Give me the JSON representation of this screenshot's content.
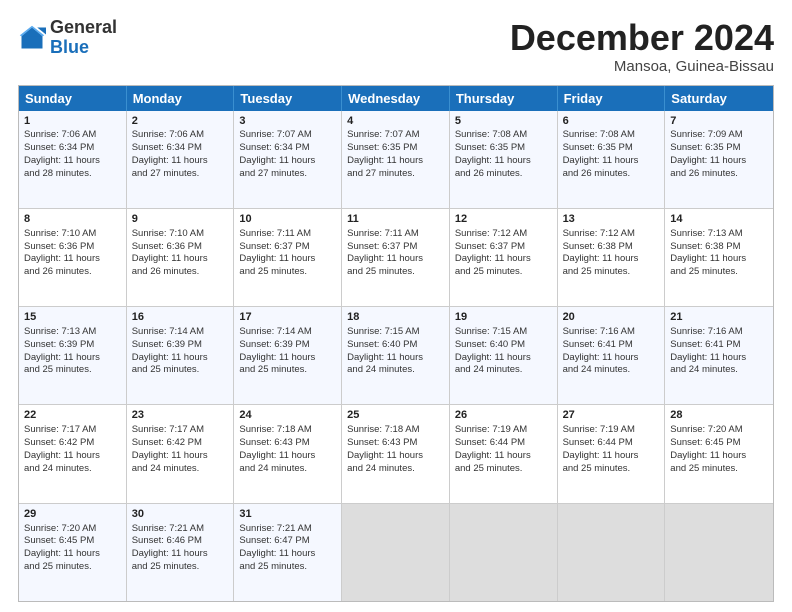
{
  "logo": {
    "general": "General",
    "blue": "Blue"
  },
  "title": "December 2024",
  "location": "Mansoa, Guinea-Bissau",
  "days_of_week": [
    "Sunday",
    "Monday",
    "Tuesday",
    "Wednesday",
    "Thursday",
    "Friday",
    "Saturday"
  ],
  "weeks": [
    [
      {
        "day": "1",
        "lines": [
          "Sunrise: 7:06 AM",
          "Sunset: 6:34 PM",
          "Daylight: 11 hours",
          "and 28 minutes."
        ]
      },
      {
        "day": "2",
        "lines": [
          "Sunrise: 7:06 AM",
          "Sunset: 6:34 PM",
          "Daylight: 11 hours",
          "and 27 minutes."
        ]
      },
      {
        "day": "3",
        "lines": [
          "Sunrise: 7:07 AM",
          "Sunset: 6:34 PM",
          "Daylight: 11 hours",
          "and 27 minutes."
        ]
      },
      {
        "day": "4",
        "lines": [
          "Sunrise: 7:07 AM",
          "Sunset: 6:35 PM",
          "Daylight: 11 hours",
          "and 27 minutes."
        ]
      },
      {
        "day": "5",
        "lines": [
          "Sunrise: 7:08 AM",
          "Sunset: 6:35 PM",
          "Daylight: 11 hours",
          "and 26 minutes."
        ]
      },
      {
        "day": "6",
        "lines": [
          "Sunrise: 7:08 AM",
          "Sunset: 6:35 PM",
          "Daylight: 11 hours",
          "and 26 minutes."
        ]
      },
      {
        "day": "7",
        "lines": [
          "Sunrise: 7:09 AM",
          "Sunset: 6:35 PM",
          "Daylight: 11 hours",
          "and 26 minutes."
        ]
      }
    ],
    [
      {
        "day": "8",
        "lines": [
          "Sunrise: 7:10 AM",
          "Sunset: 6:36 PM",
          "Daylight: 11 hours",
          "and 26 minutes."
        ]
      },
      {
        "day": "9",
        "lines": [
          "Sunrise: 7:10 AM",
          "Sunset: 6:36 PM",
          "Daylight: 11 hours",
          "and 26 minutes."
        ]
      },
      {
        "day": "10",
        "lines": [
          "Sunrise: 7:11 AM",
          "Sunset: 6:37 PM",
          "Daylight: 11 hours",
          "and 25 minutes."
        ]
      },
      {
        "day": "11",
        "lines": [
          "Sunrise: 7:11 AM",
          "Sunset: 6:37 PM",
          "Daylight: 11 hours",
          "and 25 minutes."
        ]
      },
      {
        "day": "12",
        "lines": [
          "Sunrise: 7:12 AM",
          "Sunset: 6:37 PM",
          "Daylight: 11 hours",
          "and 25 minutes."
        ]
      },
      {
        "day": "13",
        "lines": [
          "Sunrise: 7:12 AM",
          "Sunset: 6:38 PM",
          "Daylight: 11 hours",
          "and 25 minutes."
        ]
      },
      {
        "day": "14",
        "lines": [
          "Sunrise: 7:13 AM",
          "Sunset: 6:38 PM",
          "Daylight: 11 hours",
          "and 25 minutes."
        ]
      }
    ],
    [
      {
        "day": "15",
        "lines": [
          "Sunrise: 7:13 AM",
          "Sunset: 6:39 PM",
          "Daylight: 11 hours",
          "and 25 minutes."
        ]
      },
      {
        "day": "16",
        "lines": [
          "Sunrise: 7:14 AM",
          "Sunset: 6:39 PM",
          "Daylight: 11 hours",
          "and 25 minutes."
        ]
      },
      {
        "day": "17",
        "lines": [
          "Sunrise: 7:14 AM",
          "Sunset: 6:39 PM",
          "Daylight: 11 hours",
          "and 25 minutes."
        ]
      },
      {
        "day": "18",
        "lines": [
          "Sunrise: 7:15 AM",
          "Sunset: 6:40 PM",
          "Daylight: 11 hours",
          "and 24 minutes."
        ]
      },
      {
        "day": "19",
        "lines": [
          "Sunrise: 7:15 AM",
          "Sunset: 6:40 PM",
          "Daylight: 11 hours",
          "and 24 minutes."
        ]
      },
      {
        "day": "20",
        "lines": [
          "Sunrise: 7:16 AM",
          "Sunset: 6:41 PM",
          "Daylight: 11 hours",
          "and 24 minutes."
        ]
      },
      {
        "day": "21",
        "lines": [
          "Sunrise: 7:16 AM",
          "Sunset: 6:41 PM",
          "Daylight: 11 hours",
          "and 24 minutes."
        ]
      }
    ],
    [
      {
        "day": "22",
        "lines": [
          "Sunrise: 7:17 AM",
          "Sunset: 6:42 PM",
          "Daylight: 11 hours",
          "and 24 minutes."
        ]
      },
      {
        "day": "23",
        "lines": [
          "Sunrise: 7:17 AM",
          "Sunset: 6:42 PM",
          "Daylight: 11 hours",
          "and 24 minutes."
        ]
      },
      {
        "day": "24",
        "lines": [
          "Sunrise: 7:18 AM",
          "Sunset: 6:43 PM",
          "Daylight: 11 hours",
          "and 24 minutes."
        ]
      },
      {
        "day": "25",
        "lines": [
          "Sunrise: 7:18 AM",
          "Sunset: 6:43 PM",
          "Daylight: 11 hours",
          "and 24 minutes."
        ]
      },
      {
        "day": "26",
        "lines": [
          "Sunrise: 7:19 AM",
          "Sunset: 6:44 PM",
          "Daylight: 11 hours",
          "and 25 minutes."
        ]
      },
      {
        "day": "27",
        "lines": [
          "Sunrise: 7:19 AM",
          "Sunset: 6:44 PM",
          "Daylight: 11 hours",
          "and 25 minutes."
        ]
      },
      {
        "day": "28",
        "lines": [
          "Sunrise: 7:20 AM",
          "Sunset: 6:45 PM",
          "Daylight: 11 hours",
          "and 25 minutes."
        ]
      }
    ],
    [
      {
        "day": "29",
        "lines": [
          "Sunrise: 7:20 AM",
          "Sunset: 6:45 PM",
          "Daylight: 11 hours",
          "and 25 minutes."
        ]
      },
      {
        "day": "30",
        "lines": [
          "Sunrise: 7:21 AM",
          "Sunset: 6:46 PM",
          "Daylight: 11 hours",
          "and 25 minutes."
        ]
      },
      {
        "day": "31",
        "lines": [
          "Sunrise: 7:21 AM",
          "Sunset: 6:47 PM",
          "Daylight: 11 hours",
          "and 25 minutes."
        ]
      },
      null,
      null,
      null,
      null
    ]
  ]
}
